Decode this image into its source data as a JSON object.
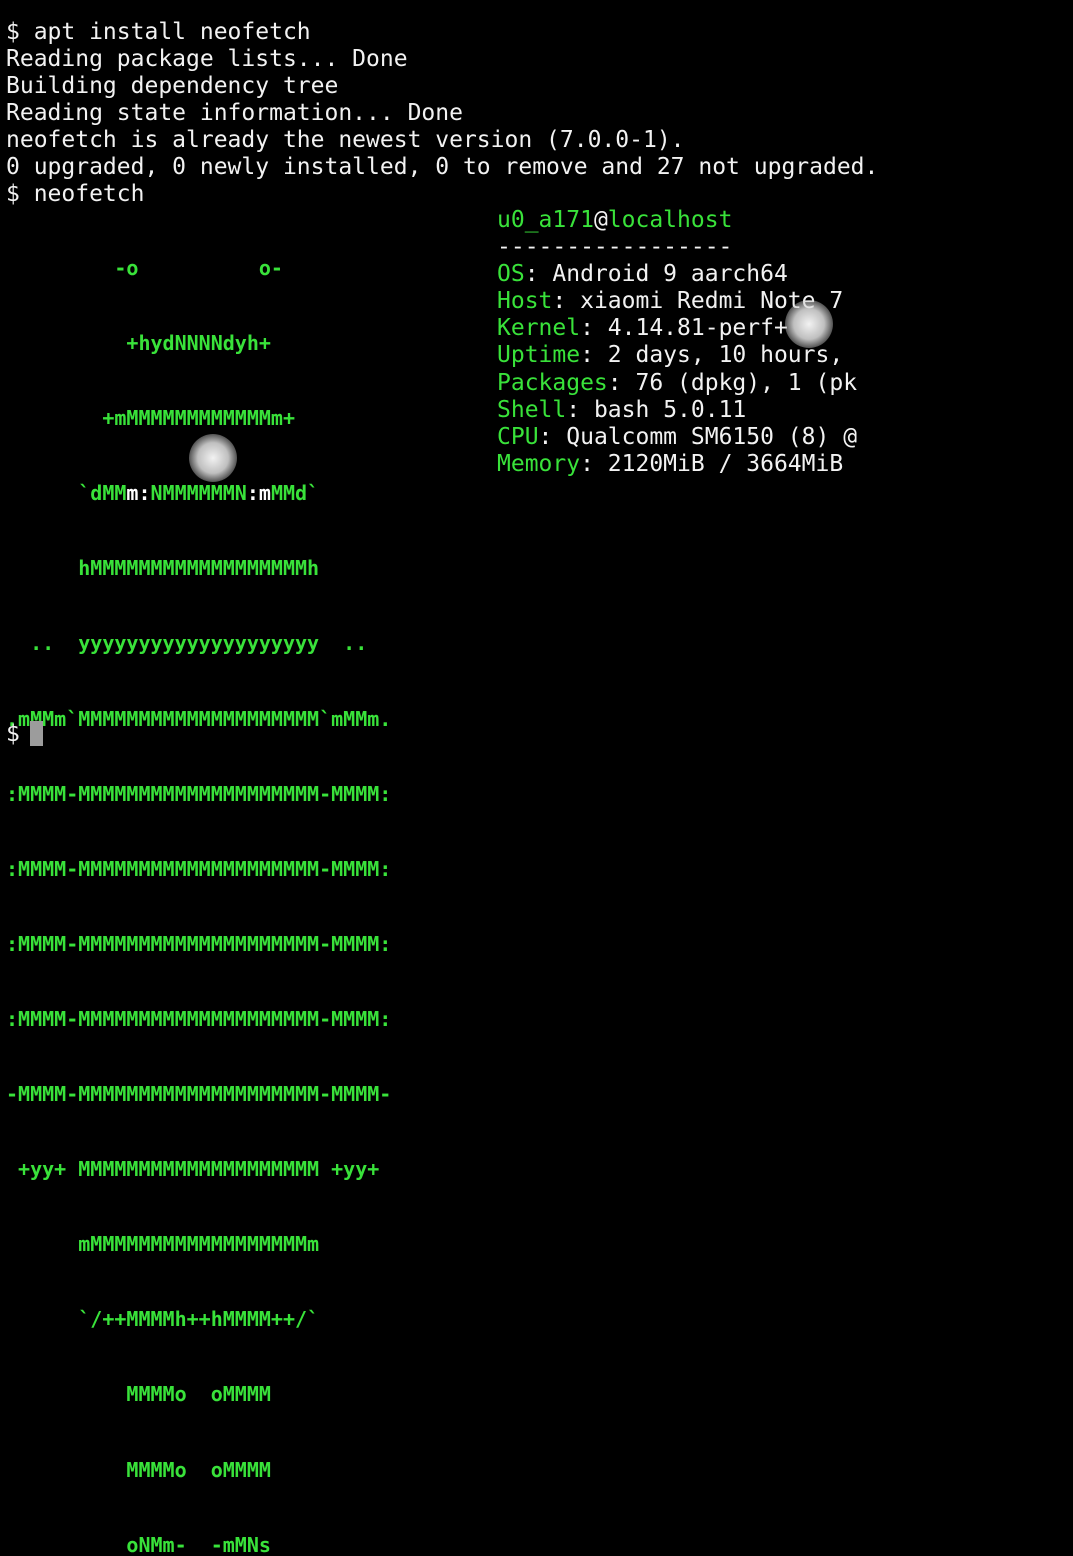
{
  "terminal": {
    "lines": [
      "$ apt install neofetch",
      "Reading package lists... Done",
      "Building dependency tree",
      "Reading state information... Done",
      "neofetch is already the newest version (7.0.0-1).",
      "0 upgraded, 0 newly installed, 0 to remove and 27 not upgraded.",
      "$ neofetch"
    ],
    "prompt": "$"
  },
  "logo": {
    "rows": [
      "         -o          o-",
      "          +hydNNNNdyh+",
      "        +mMMMMMMMMMMMMm+",
      "      `dMMm:NMMMMMMN:mMMd`",
      "      hMMMMMMMMMMMMMMMMMMh",
      "  ..  yyyyyyyyyyyyyyyyyyyy  ..",
      ".mMMm`MMMMMMMMMMMMMMMMMMMM`mMMm.",
      ":MMMM-MMMMMMMMMMMMMMMMMMMM-MMMM:",
      ":MMMM-MMMMMMMMMMMMMMMMMMMM-MMMM:",
      ":MMMM-MMMMMMMMMMMMMMMMMMMM-MMMM:",
      ":MMMM-MMMMMMMMMMMMMMMMMMMM-MMMM:",
      "-MMMM-MMMMMMMMMMMMMMMMMMMM-MMMM-",
      " +yy+ MMMMMMMMMMMMMMMMMMMM +yy+",
      "      mMMMMMMMMMMMMMMMMMMm",
      "      `/++MMMMh++hMMMM++/`",
      "          MMMMo  oMMMM",
      "          MMMMo  oMMMM",
      "          oNMm-  -mMNs"
    ],
    "eyes_row": {
      "prefix": "      `dMM",
      "eye_left": "m:",
      "middle": "NMMMMMMN",
      "eye_right": ":m",
      "suffix": "MMd`"
    }
  },
  "info": {
    "user": "u0_a171",
    "at": "@",
    "host": "localhost",
    "separator": "-----------------",
    "fields": [
      {
        "key": "OS",
        "value": "Android 9 aarch64"
      },
      {
        "key": "Host",
        "value": "xiaomi Redmi Note 7"
      },
      {
        "key": "Kernel",
        "value": "4.14.81-perf+"
      },
      {
        "key": "Uptime",
        "value": "2 days, 10 hours,"
      },
      {
        "key": "Packages",
        "value": "76 (dpkg), 1 (pk"
      },
      {
        "key": "Shell",
        "value": "bash 5.0.11"
      },
      {
        "key": "CPU",
        "value": "Qualcomm SM6150 (8) @"
      },
      {
        "key": "Memory",
        "value": "2120MiB / 3664MiB"
      }
    ],
    "colon": ": "
  },
  "colors": {
    "background": "#000000",
    "foreground": "#f2f2f2",
    "accent_green": "#39e23a",
    "cursor": "#9c9c9c"
  }
}
